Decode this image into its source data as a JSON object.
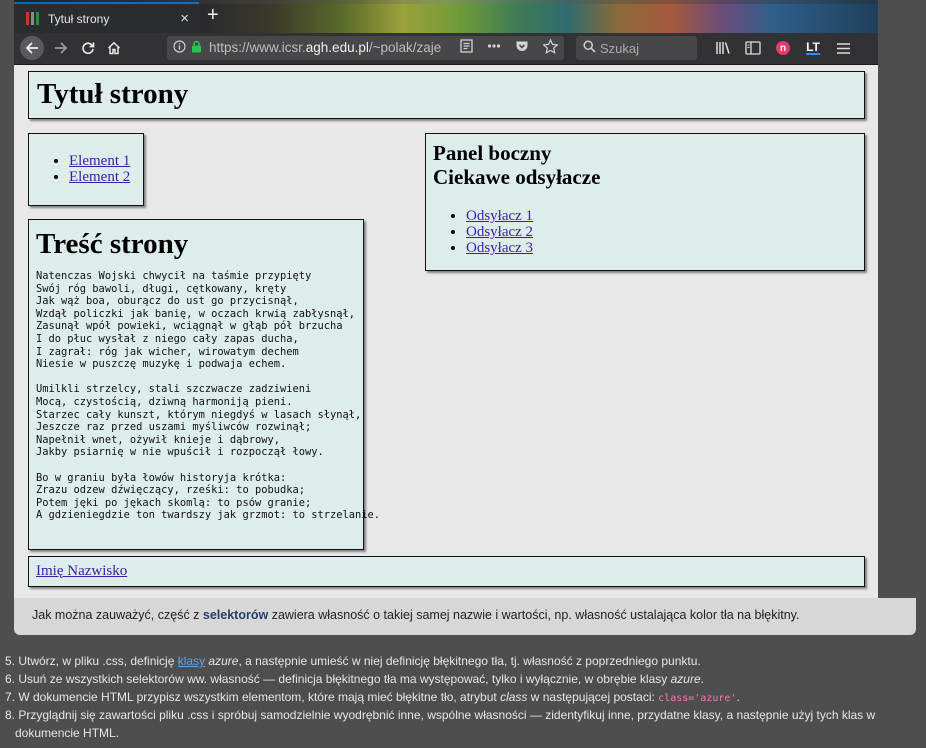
{
  "browser": {
    "tab_title": "Tytuł strony",
    "tab_close": "×",
    "new_tab": "+",
    "url_prefix": "https://www.icsr.",
    "url_domain": "agh.edu.pl",
    "url_rest": "/~polak/zaje",
    "search_placeholder": "Szukaj",
    "accent_color": "#0a84ff",
    "icons": [
      "back-icon",
      "forward-icon",
      "reload-icon",
      "home-icon",
      "info-icon",
      "lock-icon",
      "reader-view-icon",
      "more-icon",
      "pocket-icon",
      "bookmark-star-icon",
      "search-icon",
      "library-icon",
      "sidebar-icon",
      "extension-n-icon",
      "languagetool-icon",
      "menu-icon"
    ],
    "ext_n": "n",
    "ext_lt": "LT"
  },
  "page": {
    "title": "Tytuł strony",
    "menu_items": [
      "Element 1",
      "Element 2"
    ],
    "content_title": "Treść strony",
    "poem": "Natenczas Wojski chwycił na taśmie przypięty\nSwój róg bawoli, długi, cętkowany, kręty\nJak wąż boa, oburącz do ust go przycisnął,\nWzdął policzki jak banię, w oczach krwią zabłysnął,\nZasunął wpół powieki, wciągnął w głąb pół brzucha\nI do płuc wysłał z niego cały zapas ducha,\nI zagrał: róg jak wicher, wirowatym dechem\nNiesie w puszczę muzykę i podwaja echem.\n\nUmilkli strzelcy, stali szczwacze zadziwieni\nMocą, czystością, dziwną harmoniją pieni.\nStarzec cały kunszt, którym niegdyś w lasach słynął,\nJeszcze raz przed uszami myśliwców rozwinął;\nNapełnił wnet, ożywił knieje i dąbrowy,\nJakby psiarnię w nie wpuścił i rozpoczął łowy.\n\nBo w graniu była łowów historyja krótka:\nZrazu odzew dźwięczący, rześki: to pobudka;\nPotem jęki po jękach skomlą: to psów granie;\nA gdzieniegdzie ton twardszy jak grzmot: to strzelanie.",
    "side_title_1": "Panel boczny",
    "side_title_2": "Ciekawe odsyłacze",
    "side_links": [
      "Odsyłacz 1",
      "Odsyłacz 2",
      "Odsyłacz 3"
    ],
    "footer_link": "Imię Nazwisko",
    "box_bg": "#dcedec",
    "link_color": "#3f1da3"
  },
  "note": {
    "part1": "Jak można zauważyć, część z ",
    "bold": "selektorów",
    "part2": " zawiera własność o takiej samej nazwie i wartości, np. własność ustalająca kolor tła na błękitny."
  },
  "steps": [
    {
      "num": "5.",
      "a": "Utwórz, w pliku .css, definicję ",
      "link": "klasy",
      "b": " ",
      "em": "azure",
      "c": ", a następnie umieść w niej definicję błękitnego tła, tj. własność z poprzedniego punktu."
    },
    {
      "num": "6.",
      "a": "Usuń ze wszystkich selektorów ww. własność — definicja błękitnego tła ma występować, tylko i wyłącznie, w obrębie klasy ",
      "em": "azure",
      "c": "."
    },
    {
      "num": "7.",
      "a": "W dokumencie HTML przypisz wszystkim elementom, które mają mieć błękitne tło, atrybut ",
      "em": "class",
      "c": " w następującej postaci: ",
      "code": "class='azure'",
      "d": "."
    },
    {
      "num": "8.",
      "a": "Przyglądnij się zawartości pliku .css i spróbuj samodzielnie wyodrębnić inne, wspólne własności — zidentyfikuj inne, przydatne klasy, a następnie użyj tych klas w",
      "line2": "dokumencie HTML."
    }
  ]
}
